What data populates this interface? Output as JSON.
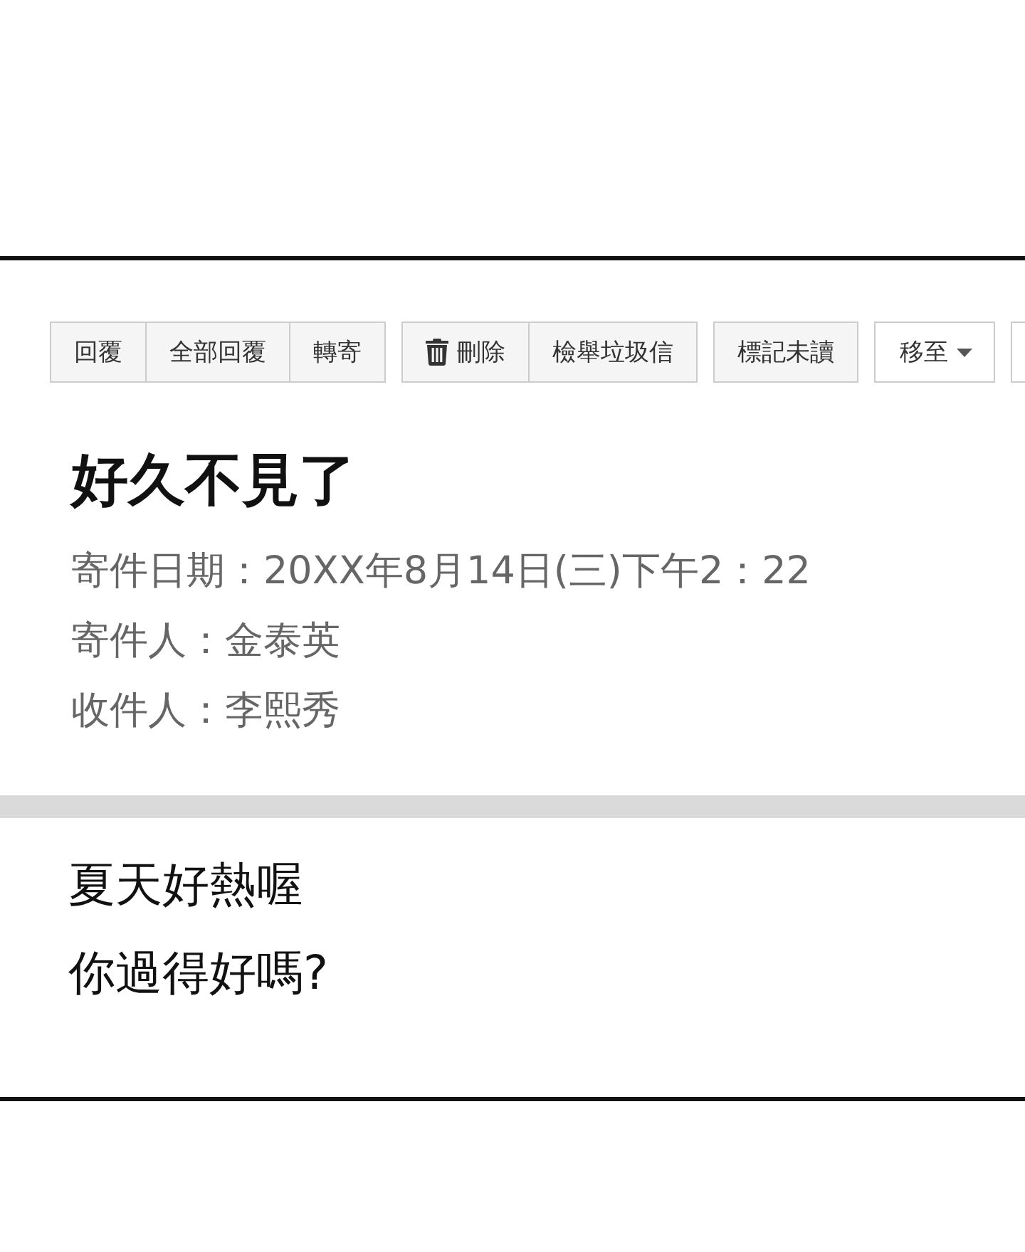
{
  "toolbar": {
    "groups": [
      {
        "buttons": [
          {
            "kind": "plain",
            "label": "回覆"
          },
          {
            "kind": "plain",
            "label": "全部回覆"
          },
          {
            "kind": "plain",
            "label": "轉寄"
          }
        ]
      },
      {
        "buttons": [
          {
            "kind": "delete",
            "label": "刪除"
          },
          {
            "kind": "plain",
            "label": "檢舉垃圾信"
          }
        ]
      },
      {
        "buttons": [
          {
            "kind": "plain",
            "label": "標記未讀"
          }
        ]
      },
      {
        "buttons": [
          {
            "kind": "dropdown",
            "label": "移至"
          }
        ]
      },
      {
        "buttons": [
          {
            "kind": "clipped"
          }
        ]
      }
    ]
  },
  "message": {
    "subject": "好久不見了",
    "meta": [
      "寄件日期：20XX年8月14日(三)下午2：22",
      "寄件人：金泰英",
      "收件人：李熙秀"
    ]
  },
  "body": {
    "lines": [
      "夏天好熱喔",
      "你過得好嗎?"
    ]
  }
}
